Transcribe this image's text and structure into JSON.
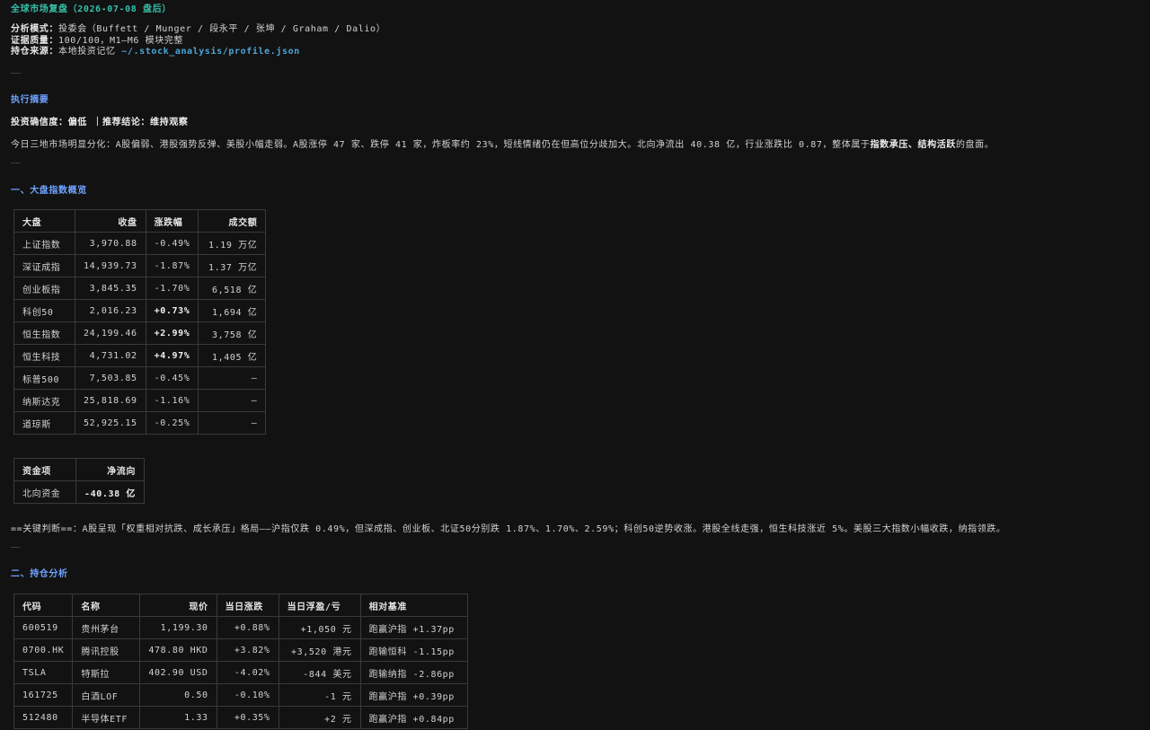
{
  "header": {
    "title": "全球市场复盘（2026-07-08 盘后）",
    "mode_label": "分析模式：",
    "mode_value": "投委会（Buffett / Munger / 段永平 / 张坤 / Graham / Dalio）",
    "quality_label": "证据质量：",
    "quality_value": "100/100，M1–M6 模块完整",
    "source_label": "持仓来源：",
    "source_value": "本地投资记忆 ",
    "source_path": "~/.stock_analysis/profile.json"
  },
  "separator": "——",
  "summary": {
    "heading": "执行摘要",
    "confidence": "投资确信度：偏低 ｜推荐结论：维持观察",
    "text_main": "今日三地市场明显分化：A股偏弱、港股强势反弹、美股小幅走弱。A股涨停 47 家、跌停 41 家，炸板率约 23%，短线情绪仍在但高位分歧加大。北向净流出 40.38 亿，行业涨跌比 0.87，整体属于",
    "text_bold": "指数承压、结构活跃",
    "text_tail": "的盘面。"
  },
  "section1": {
    "heading": "一、大盘指数概览",
    "index_table": {
      "headers": [
        "大盘",
        "收盘",
        "涨跌幅",
        "成交额"
      ],
      "rows": [
        [
          "上证指数",
          "3,970.88",
          "-0.49%",
          "1.19 万亿"
        ],
        [
          "深证成指",
          "14,939.73",
          "-1.87%",
          "1.37 万亿"
        ],
        [
          "创业板指",
          "3,845.35",
          "-1.70%",
          "6,518 亿"
        ],
        [
          "科创50",
          "2,016.23",
          "+0.73%",
          "1,694 亿"
        ],
        [
          "恒生指数",
          "24,199.46",
          "+2.99%",
          "3,758 亿"
        ],
        [
          "恒生科技",
          "4,731.02",
          "+4.97%",
          "1,405 亿"
        ],
        [
          "标普500",
          "7,503.85",
          "-0.45%",
          "—"
        ],
        [
          "纳斯达克",
          "25,818.69",
          "-1.16%",
          "—"
        ],
        [
          "道琼斯",
          "52,925.15",
          "-0.25%",
          "—"
        ]
      ]
    },
    "flow_table": {
      "headers": [
        "资金项",
        "净流向"
      ],
      "rows": [
        [
          "北向资金",
          "-40.38 亿"
        ]
      ]
    },
    "key_judgement": "==关键判断==：A股呈现「权重相对抗跌、成长承压」格局——沪指仅跌 0.49%，但深成指、创业板、北证50分别跌 1.87%、1.70%、2.59%；科创50逆势收涨。港股全线走强，恒生科技涨近 5%。美股三大指数小幅收跌，纳指领跌。"
  },
  "section2": {
    "heading": "二、持仓分析",
    "holdings_table": {
      "headers": [
        "代码",
        "名称",
        "现价",
        "当日涨跌",
        "当日浮盈/亏",
        "相对基准"
      ],
      "rows": [
        [
          "600519",
          "贵州茅台",
          "1,199.30",
          "+0.88%",
          "+1,050 元",
          "跑赢沪指 +1.37pp"
        ],
        [
          "0700.HK",
          "腾讯控股",
          "478.80 HKD",
          "+3.82%",
          "+3,520 港元",
          "跑输恒科 -1.15pp"
        ],
        [
          "TSLA",
          "特斯拉",
          "402.90 USD",
          "-4.02%",
          "-844 美元",
          "跑输纳指 -2.86pp"
        ],
        [
          "161725",
          "白酒LOF",
          "0.50",
          "-0.10%",
          "-1 元",
          "跑赢沪指 +0.39pp"
        ],
        [
          "512480",
          "半导体ETF",
          "1.33",
          "+0.35%",
          "+2 元",
          "跑赢沪指 +0.84pp"
        ]
      ]
    }
  }
}
